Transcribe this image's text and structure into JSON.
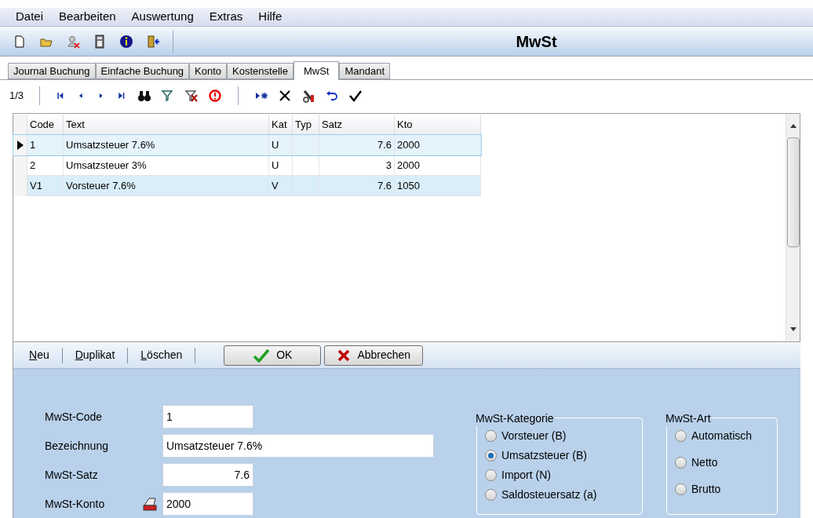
{
  "menu": [
    "Datei",
    "Bearbeiten",
    "Auswertung",
    "Extras",
    "Hilfe"
  ],
  "toolbar": {
    "title": "MwSt"
  },
  "tabs": [
    {
      "label": "Journal Buchung",
      "selected": false
    },
    {
      "label": "Einfache Buchung",
      "selected": false
    },
    {
      "label": "Konto",
      "selected": false
    },
    {
      "label": "Kostenstelle",
      "selected": false
    },
    {
      "label": "MwSt",
      "selected": true
    },
    {
      "label": "Mandant",
      "selected": false
    }
  ],
  "navigator": {
    "position": "1/3"
  },
  "table": {
    "columns": [
      "Code",
      "Text",
      "Kat",
      "Typ",
      "Satz",
      "Kto"
    ],
    "rows": [
      {
        "cells": [
          "1",
          "Umsatzsteuer 7.6%",
          "U",
          "",
          "7.6",
          "2000"
        ],
        "selected": true
      },
      {
        "cells": [
          "2",
          "Umsatzsteuer 3%",
          "U",
          "",
          "3",
          "2000"
        ],
        "selected": false
      },
      {
        "cells": [
          "V1",
          "Vorsteuer 7.6%",
          "V",
          "",
          "7.6",
          "1050"
        ],
        "selected": false
      }
    ]
  },
  "actions": [
    "Neu",
    "Duplikat",
    "Löschen"
  ],
  "buttons": [
    {
      "kind": "ok",
      "label": "OK"
    },
    {
      "kind": "cancel",
      "label": "Abbrechen"
    }
  ],
  "form": {
    "fields": [
      {
        "label": "MwSt-Code",
        "value": "1",
        "kind": "short"
      },
      {
        "label": "Bezeichnung",
        "value": "Umsatzsteuer 7.6%",
        "kind": "long"
      },
      {
        "label": "MwSt-Satz",
        "value": "7.6",
        "kind": "number"
      },
      {
        "label": "MwSt-Konto",
        "value": "2000",
        "kind": "lookup"
      }
    ],
    "groups": [
      {
        "title": "MwSt-Kategorie",
        "options": [
          {
            "label": "Vorsteuer (B)",
            "selected": false
          },
          {
            "label": "Umsatzsteuer (B)",
            "selected": true
          },
          {
            "label": "Import (N)",
            "selected": false
          },
          {
            "label": "Saldosteuersatz (a)",
            "selected": false
          }
        ]
      },
      {
        "title": "MwSt-Art",
        "options": [
          {
            "label": "Automatisch",
            "selected": false
          },
          {
            "label": "Netto",
            "selected": false
          },
          {
            "label": "Brutto",
            "selected": false
          }
        ]
      }
    ]
  }
}
